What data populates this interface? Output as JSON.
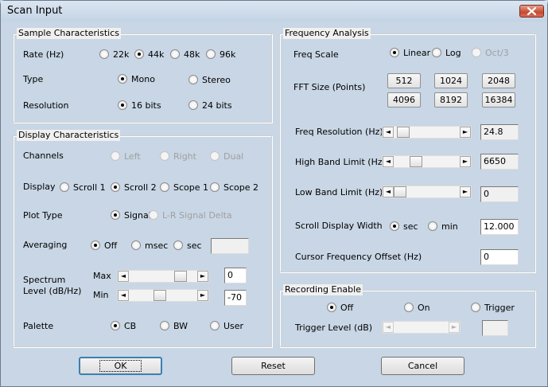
{
  "window": {
    "title": "Scan Input"
  },
  "sample": {
    "title": "Sample Characteristics",
    "rate_label": "Rate (Hz)",
    "rates": [
      "22k",
      "44k",
      "48k",
      "96k"
    ],
    "rate_selected": "44k",
    "type_label": "Type",
    "types": [
      "Mono",
      "Stereo"
    ],
    "type_selected": "Mono",
    "resolution_label": "Resolution",
    "resolutions": [
      "16 bits",
      "24 bits"
    ],
    "resolution_selected": "16 bits"
  },
  "display": {
    "title": "Display Characteristics",
    "channels_label": "Channels",
    "channels": [
      "Left",
      "Right",
      "Dual"
    ],
    "display_label": "Display",
    "displays": [
      "Scroll 1",
      "Scroll 2",
      "Scope 1",
      "Scope 2"
    ],
    "display_selected": "Scroll 2",
    "plot_label": "Plot Type",
    "plots": [
      "Signal",
      "L-R Signal Delta"
    ],
    "plot_selected": "Signal",
    "averaging_label": "Averaging",
    "averagings": [
      "Off",
      "msec",
      "sec"
    ],
    "averaging_selected": "Off",
    "averaging_value": "",
    "spectrum_label_1": "Spectrum",
    "spectrum_label_2": "Level (dB/Hz)",
    "max_label": "Max",
    "max_value": "0",
    "min_label": "Min",
    "min_value": "-70",
    "palette_label": "Palette",
    "palettes": [
      "CB",
      "BW",
      "User"
    ],
    "palette_selected": "CB"
  },
  "frequency": {
    "title": "Frequency Analysis",
    "scale_label": "Freq Scale",
    "scales": [
      "Linear",
      "Log",
      "Oct/3"
    ],
    "scale_selected": "Linear",
    "fft_label": "FFT Size (Points)",
    "fft_sizes": [
      "512",
      "1024",
      "2048",
      "4096",
      "8192",
      "16384"
    ],
    "resolution_label": "Freq Resolution (Hz)",
    "resolution_value": "24.8",
    "high_label": "High Band Limit (Hz)",
    "high_value": "6650",
    "low_label": "Low Band Limit (Hz)",
    "low_value": "0",
    "scroll_label": "Scroll Display Width",
    "scroll_units": [
      "sec",
      "min"
    ],
    "scroll_unit_selected": "sec",
    "scroll_value": "12.000",
    "cursor_label": "Cursor Frequency Offset (Hz)",
    "cursor_value": "0"
  },
  "recording": {
    "title": "Recording Enable",
    "modes": [
      "Off",
      "On",
      "Trigger"
    ],
    "mode_selected": "Off",
    "trigger_label": "Trigger Level (dB)",
    "trigger_value": ""
  },
  "buttons": {
    "ok": "OK",
    "reset": "Reset",
    "cancel": "Cancel"
  },
  "colors": {
    "close_button": "#c6492f",
    "title_bar": "#c8d6e5",
    "default_button_border": "#3c7fb1"
  }
}
